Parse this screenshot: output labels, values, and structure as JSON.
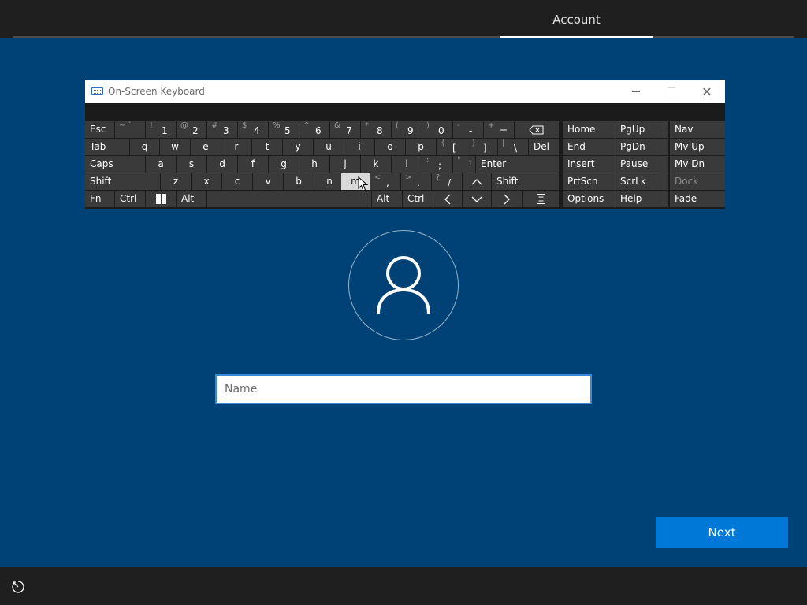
{
  "header": {
    "tab_label": "Account"
  },
  "osk": {
    "title": "On-Screen Keyboard",
    "keys": {
      "esc": "Esc",
      "k1": [
        "~ `",
        ""
      ],
      "k2": [
        "!",
        "1"
      ],
      "k3": [
        "@",
        "2"
      ],
      "k4": [
        "#",
        "3"
      ],
      "k5": [
        "$",
        "4"
      ],
      "k6": [
        "%",
        "5"
      ],
      "k7": [
        "^",
        "6"
      ],
      "k8": [
        "&",
        "7"
      ],
      "k9": [
        "*",
        "8"
      ],
      "k10": [
        "(",
        "9"
      ],
      "k11": [
        ")",
        "0"
      ],
      "k12": [
        "-",
        "-"
      ],
      "k13": [
        "+",
        "="
      ],
      "tab": "Tab",
      "q": "q",
      "w": "w",
      "e": "e",
      "r": "r",
      "t": "t",
      "y": "y",
      "u": "u",
      "i": "i",
      "o": "o",
      "p": "p",
      "lbr": [
        "{",
        "["
      ],
      "rbr": [
        "}",
        "]"
      ],
      "bsl": [
        "|",
        "\\"
      ],
      "del": "Del",
      "caps": "Caps",
      "a": "a",
      "s": "s",
      "d": "d",
      "f": "f",
      "g": "g",
      "h": "h",
      "j": "j",
      "k": "k",
      "l": "l",
      "semi": [
        ":",
        ";"
      ],
      "quote": [
        "\"",
        "'"
      ],
      "enter": "Enter",
      "shift": "Shift",
      "z": "z",
      "x": "x",
      "c": "c",
      "v": "v",
      "b": "b",
      "n": "n",
      "m": "m",
      "comma": [
        "<",
        ","
      ],
      "period": [
        ">",
        "."
      ],
      "slash": [
        "?",
        "/"
      ],
      "shift2": "Shift",
      "fn": "Fn",
      "ctrl": "Ctrl",
      "alt": "Alt",
      "altgr": "Alt",
      "ctrl2": "Ctrl",
      "home": "Home",
      "pgup": "PgUp",
      "nav": "Nav",
      "end": "End",
      "pgdn": "PgDn",
      "mvup": "Mv Up",
      "insert": "Insert",
      "pause": "Pause",
      "mvdn": "Mv Dn",
      "prtscn": "PrtScn",
      "scrlk": "ScrLk",
      "dock": "Dock",
      "options": "Options",
      "help": "Help",
      "fade": "Fade"
    }
  },
  "form": {
    "name_placeholder": "Name",
    "name_value": ""
  },
  "actions": {
    "next_label": "Next"
  }
}
